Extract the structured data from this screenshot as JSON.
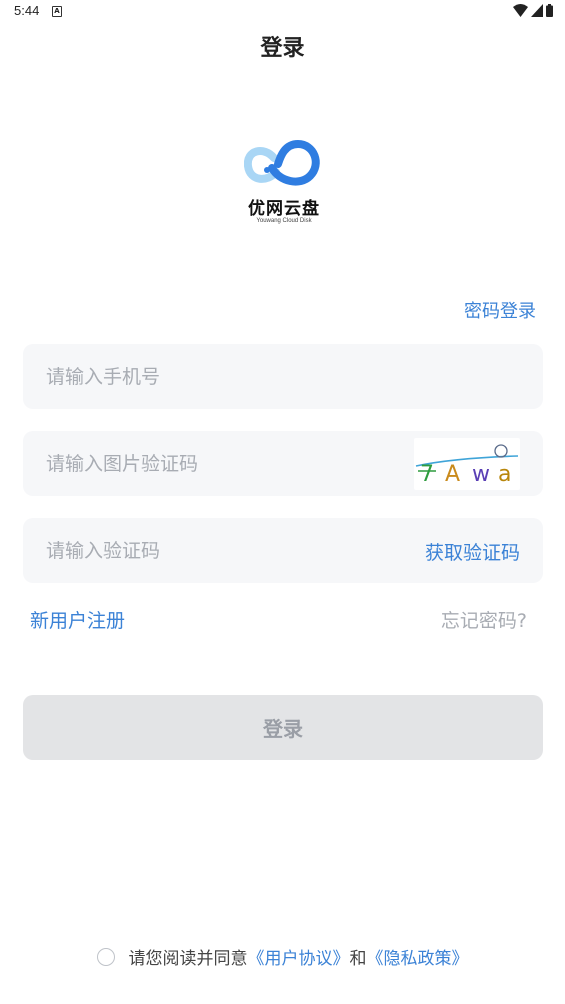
{
  "status_bar": {
    "time": "5:44",
    "notification_icon": "A"
  },
  "header": {
    "title": "登录"
  },
  "logo": {
    "name": "优网云盘",
    "subtitle": "Youwang Cloud Disk"
  },
  "password_login_label": "密码登录",
  "phone_field": {
    "placeholder": "请输入手机号",
    "value": ""
  },
  "captcha_field": {
    "placeholder": "请输入图片验证码",
    "value": "",
    "captcha_text": [
      "7",
      "A",
      "w",
      "a"
    ],
    "captcha_colors": [
      "#2e9c3e",
      "#c98a1c",
      "#5a3fb5",
      "#b8860b"
    ]
  },
  "code_field": {
    "placeholder": "请输入验证码",
    "value": "",
    "get_code_label": "获取验证码"
  },
  "register_label": "新用户注册",
  "forgot_label": "忘记密码?",
  "login_button": "登录",
  "agreement": {
    "prefix": "请您阅读并同意",
    "user_agreement": "《用户协议》",
    "and": "和",
    "privacy_policy": "《隐私政策》"
  },
  "colors": {
    "accent": "#3b82d6",
    "placeholder": "#a8acb3",
    "field_bg": "#f6f7f9",
    "button_disabled": "#e3e4e6"
  }
}
